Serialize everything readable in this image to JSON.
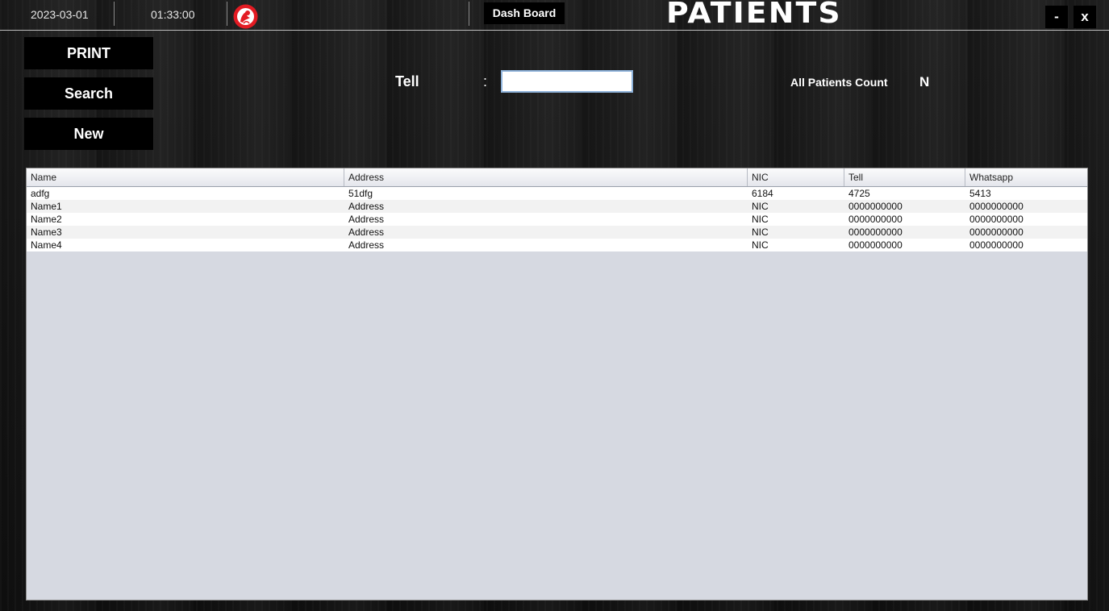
{
  "header": {
    "date": "2023-03-01",
    "time": "01:33:00",
    "logo_icon": "red-brand-logo-icon",
    "dashboard_label": "Dash Board",
    "title": "PATIENTS",
    "minimize_label": "-",
    "close_label": "x"
  },
  "sidebar": {
    "print_label": "PRINT",
    "search_label": "Search",
    "new_label": "New"
  },
  "search": {
    "tell_label": "Tell",
    "colon": ":",
    "tell_value": "",
    "count_label": "All Patients Count",
    "count_value": "N"
  },
  "table": {
    "columns": [
      "Name",
      "Address",
      "NIC",
      "Tell",
      "Whatsapp"
    ],
    "rows": [
      [
        "adfg",
        "51dfg",
        "6184",
        "4725",
        "5413"
      ],
      [
        "Name1",
        "Address",
        "NIC",
        "0000000000",
        "0000000000"
      ],
      [
        "Name2",
        "Address",
        "NIC",
        "0000000000",
        "0000000000"
      ],
      [
        "Name3",
        "Address",
        "NIC",
        "0000000000",
        "0000000000"
      ],
      [
        "Name4",
        "Address",
        "NIC",
        "0000000000",
        "0000000000"
      ]
    ]
  },
  "colors": {
    "accent_red": "#e31b23",
    "table_bg": "#d6d9e1",
    "input_border": "#8fb3da"
  }
}
